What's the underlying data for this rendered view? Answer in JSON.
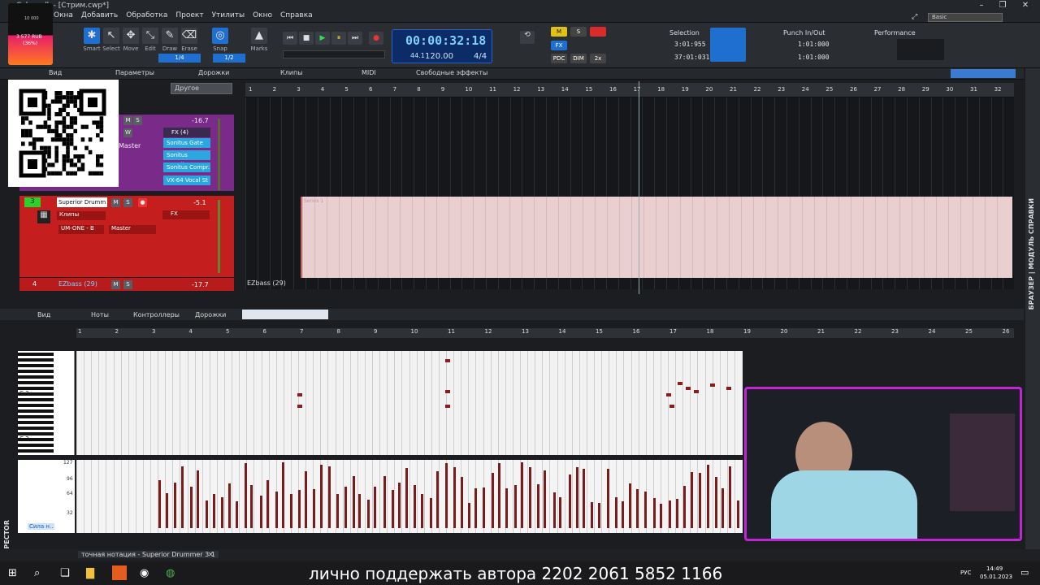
{
  "titlebar": {
    "title": "Cakewalk - [Стрим.cwp*]"
  },
  "menu": [
    "Окна",
    "Добавить",
    "Обработка",
    "Проект",
    "Утилиты",
    "Окно",
    "Справка"
  ],
  "workspace": "Basic",
  "tools": [
    {
      "icon": "smart-icon",
      "label": "Smart",
      "on": true
    },
    {
      "icon": "select-icon",
      "label": "Select",
      "on": false
    },
    {
      "icon": "move-icon",
      "label": "Move",
      "on": false
    },
    {
      "icon": "edit-icon",
      "label": "Edit",
      "on": false
    },
    {
      "icon": "draw-icon",
      "label": "Draw",
      "on": false
    },
    {
      "icon": "erase-icon",
      "label": "Erase",
      "on": false
    }
  ],
  "snap": {
    "label": "Snap",
    "value": "1/4",
    "marks_label": "Marks",
    "snap_value2": "1/2"
  },
  "transport": {
    "time": "00:00:32:18",
    "tempo": "120.00",
    "meter": "4/4",
    "small1": "44.1",
    "small2": "32"
  },
  "modules": [
    "M",
    "S",
    "FX",
    "PDC",
    "DIM",
    "2x"
  ],
  "selection": {
    "label": "Selection",
    "start": "3:01:955",
    "end": "37:01:031"
  },
  "punch": {
    "label": "Punch In/Out",
    "start": "1:01:000",
    "end": "1:01:000"
  },
  "performance": {
    "label": "Performance"
  },
  "track_menu": [
    "Вид",
    "Параметры",
    "Дорожки",
    "Клипы",
    "MIDI",
    "Свободные эффекты"
  ],
  "dropdown": "Другое",
  "ruler_ticks": [
    "1",
    "2",
    "3",
    "4",
    "5",
    "6",
    "7",
    "8",
    "9",
    "10",
    "11",
    "12",
    "13",
    "14",
    "15",
    "16",
    "17",
    "18",
    "19",
    "20",
    "21",
    "22",
    "23",
    "24",
    "25",
    "26",
    "27",
    "28",
    "29",
    "30",
    "31",
    "32"
  ],
  "track2": {
    "fx_label": "FX (4)",
    "fx": [
      "Sonitus Gate",
      "Sonitus Equalizer",
      "Sonitus Compr.",
      "VX-64 Vocal St"
    ],
    "volume": "-16.7",
    "output": "Master"
  },
  "track3": {
    "number": "3",
    "name": "Superior Drumm",
    "clip_label": "Клипы",
    "input": "UM-ONE - B",
    "output": "Master",
    "volume": "-5.1",
    "fx_label": "FX"
  },
  "track4": {
    "number": "4",
    "name": "EZbass (29)",
    "volume": "-17.7"
  },
  "clip": {
    "name": "Series 1",
    "bottom_label": "EZbass (29)"
  },
  "piano_menu": [
    "Вид",
    "Ноты",
    "Контроллеры",
    "Дорожки"
  ],
  "piano_ruler_ticks": [
    "1",
    "2",
    "3",
    "4",
    "5",
    "6",
    "7",
    "8",
    "9",
    "10",
    "11",
    "12",
    "13",
    "14",
    "15",
    "16",
    "17",
    "18",
    "19",
    "20",
    "21",
    "22",
    "23",
    "24",
    "25",
    "26"
  ],
  "keys": [
    "C 3",
    "C 2"
  ],
  "velocity": {
    "label": "Сила н..",
    "scale": [
      "127",
      "96",
      "64",
      "32"
    ]
  },
  "tab": "точная нотация - Superior Drummer 3 1",
  "inspector": "SPECTOR",
  "sidebar_text": "БРАУЗЕР | МОДУЛЬ СПРАВКИ",
  "donate": {
    "amount": "3 577 RUB",
    "percent": "(36%)",
    "goal": "10 000"
  },
  "banner": "лично поддержать автора 2202 2061 5852 1166",
  "clock": {
    "time": "14:49",
    "date": "05.01.2023",
    "lang": "РУС"
  }
}
